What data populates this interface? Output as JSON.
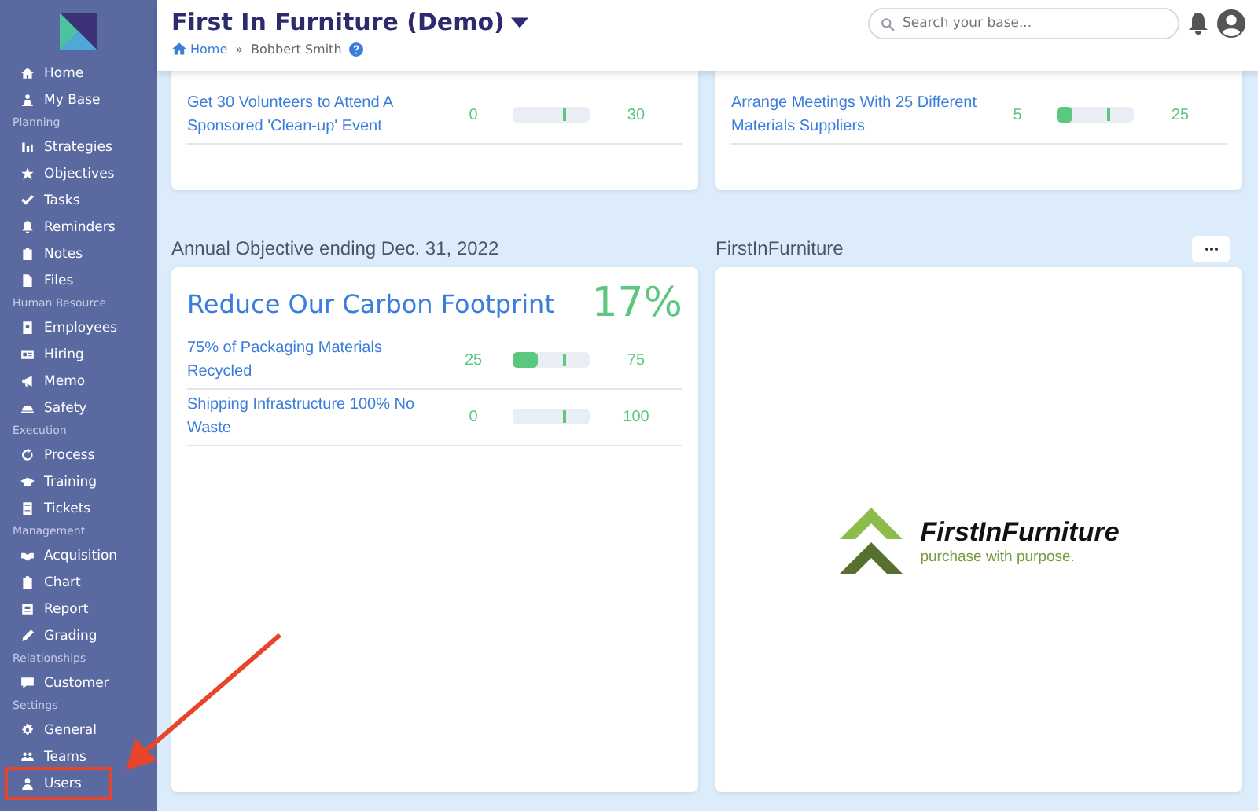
{
  "sidebar": {
    "sections": [
      {
        "items": [
          {
            "label": "Home",
            "annotated": false
          },
          {
            "label": "My Base",
            "annotated": false
          }
        ]
      },
      {
        "label": "Planning",
        "items": [
          {
            "label": "Strategies",
            "annotated": false
          },
          {
            "label": "Objectives",
            "annotated": false
          },
          {
            "label": "Tasks",
            "annotated": false
          },
          {
            "label": "Reminders",
            "annotated": false
          },
          {
            "label": "Notes",
            "annotated": false
          },
          {
            "label": "Files",
            "annotated": false
          }
        ]
      },
      {
        "label": "Human Resource",
        "items": [
          {
            "label": "Employees",
            "annotated": false
          },
          {
            "label": "Hiring",
            "annotated": false
          },
          {
            "label": "Memo",
            "annotated": false
          },
          {
            "label": "Safety",
            "annotated": false
          }
        ]
      },
      {
        "label": "Execution",
        "items": [
          {
            "label": "Process",
            "annotated": false
          },
          {
            "label": "Training",
            "annotated": false
          },
          {
            "label": "Tickets",
            "annotated": false
          }
        ]
      },
      {
        "label": "Management",
        "items": [
          {
            "label": "Acquisition",
            "annotated": false
          },
          {
            "label": "Chart",
            "annotated": false
          },
          {
            "label": "Report",
            "annotated": false
          },
          {
            "label": "Grading",
            "annotated": false
          }
        ]
      },
      {
        "label": "Relationships",
        "items": [
          {
            "label": "Customer",
            "annotated": false
          }
        ]
      },
      {
        "label": "Settings",
        "items": [
          {
            "label": "General",
            "annotated": false
          },
          {
            "label": "Teams",
            "annotated": false
          },
          {
            "label": "Users",
            "annotated": true
          }
        ]
      }
    ]
  },
  "header": {
    "title": "First In Furniture (Demo)",
    "breadcrumb": {
      "home": "Home",
      "separator": "»",
      "current": "Bobbert Smith"
    },
    "search": {
      "placeholder": "Search your base..."
    }
  },
  "top_cards": [
    {
      "rows": [
        {
          "name": "Get 30 Volunteers to Attend A Sponsored 'Clean-up' Event",
          "current": "0",
          "level": 0,
          "target": "30"
        }
      ]
    },
    {
      "rows": [
        {
          "name": "Arrange Meetings With 25 Different Materials Suppliers",
          "current": "5",
          "level": 0.2,
          "target": "25"
        }
      ]
    }
  ],
  "objective_panel": {
    "heading": "Annual Objective ending Dec. 31, 2022",
    "title": "Reduce Our Carbon Footprint",
    "percent": "17%",
    "rows": [
      {
        "name": "75% of Packaging Materials Recycled",
        "current": "25",
        "level": 0.33,
        "target": "75"
      },
      {
        "name": "Shipping Infrastructure 100% No Waste",
        "current": "0",
        "level": 0,
        "target": "100"
      }
    ]
  },
  "logo_panel": {
    "heading": "FirstInFurniture",
    "brand": "FirstInFurniture",
    "tagline": "purchase with purpose."
  }
}
